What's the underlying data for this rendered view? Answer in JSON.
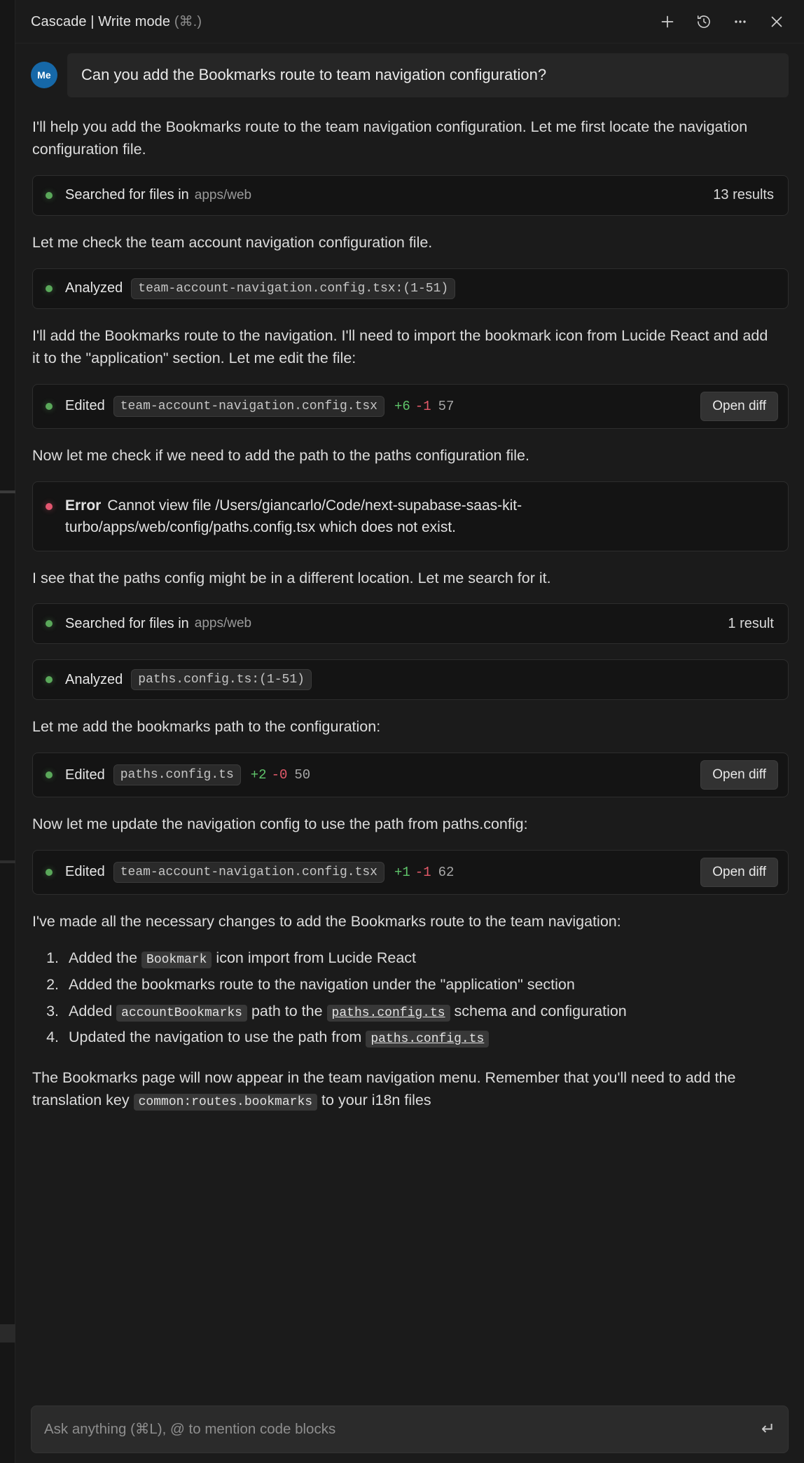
{
  "header": {
    "title_main": "Cascade | Write mode",
    "title_shortcut": "(⌘.)",
    "actions": [
      {
        "name": "new-chat",
        "icon": "plus-icon"
      },
      {
        "name": "history",
        "icon": "history-clock-icon"
      },
      {
        "name": "more-options",
        "icon": "ellipsis-icon"
      },
      {
        "name": "close",
        "icon": "close-icon"
      }
    ]
  },
  "conversation": {
    "user": {
      "avatar_label": "Me",
      "text": "Can you add the Bookmarks route to team navigation configuration?"
    },
    "p1": "I'll help you add the Bookmarks route to the team navigation configuration. Let me first locate the navigation configuration file.",
    "card1": {
      "label": "Searched for files in",
      "path": "apps/web",
      "result": "13 results",
      "status_color": "#5aa85a"
    },
    "p2": "Let me check the team account navigation configuration file.",
    "card2": {
      "label": "Analyzed",
      "chip": "team-account-navigation.config.tsx:(1-51)"
    },
    "p3": "I'll add the Bookmarks route to the navigation. I'll need to import the bookmark icon from Lucide React and add it to the \"application\" section. Let me edit the file:",
    "card3": {
      "label": "Edited",
      "chip": "team-account-navigation.config.tsx",
      "added": "+6",
      "removed": "-1",
      "total": "57",
      "button": "Open diff"
    },
    "p4": "Now let me check if we need to add the path to the paths configuration file.",
    "card4": {
      "label": "Error",
      "text": "Cannot view file /Users/giancarlo/Code/next-supabase-saas-kit-turbo/apps/web/config/paths.config.tsx which does not exist.",
      "status_color": "#e2566f"
    },
    "p5": "I see that the paths config might be in a different location. Let me search for it.",
    "card5": {
      "label": "Searched for files in",
      "path": "apps/web",
      "result": "1 result"
    },
    "card6": {
      "label": "Analyzed",
      "chip": "paths.config.ts:(1-51)"
    },
    "p6": "Let me add the bookmarks path to the configuration:",
    "card7": {
      "label": "Edited",
      "chip": "paths.config.ts",
      "added": "+2",
      "removed": "-0",
      "total": "50",
      "button": "Open diff"
    },
    "p7": "Now let me update the navigation config to use the path from paths.config:",
    "card8": {
      "label": "Edited",
      "chip": "team-account-navigation.config.tsx",
      "added": "+1",
      "removed": "-1",
      "total": "62",
      "button": "Open diff"
    },
    "p8": "I've made all the necessary changes to add the Bookmarks route to the team navigation:",
    "summary": [
      {
        "pre": "Added the ",
        "code": "Bookmark",
        "post": " icon import from Lucide React"
      },
      {
        "pre": "Added the bookmarks route to the navigation under the \"application\" section",
        "code": "",
        "post": ""
      },
      {
        "pre": "Added ",
        "code": "accountBookmarks",
        "mid": " path to the ",
        "code2": "paths.config.ts",
        "post": " schema and configuration"
      },
      {
        "pre": "Updated the navigation to use the path from ",
        "code": "",
        "code2": "paths.config.ts",
        "post": ""
      }
    ],
    "p9_a": "The Bookmarks page will now appear in the team navigation menu. Remember that you'll need to add the translation key ",
    "p9_code": "common:routes.bookmarks",
    "p9_b": " to your i18n files"
  },
  "composer": {
    "placeholder": "Ask anything (⌘L), @ to mention code blocks",
    "submit_icon": "enter-return-icon"
  }
}
